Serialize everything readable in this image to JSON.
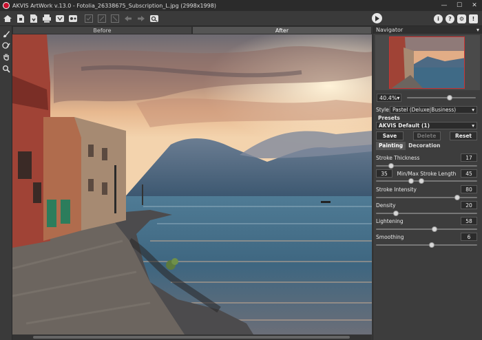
{
  "window": {
    "title": "AKVIS ArtWork v.13.0 - Fotolia_26338675_Subscription_L.jpg (2998x1998)",
    "min_symbol": "—",
    "max_symbol": "☐",
    "close_symbol": "✕"
  },
  "toolbar": {
    "icons": [
      "home-icon",
      "open-icon",
      "save-icon",
      "print-icon",
      "batch-icon",
      "plugins-icon",
      "apply-icon",
      "undo-disabled-icon",
      "redo-disabled-icon",
      "back-icon",
      "forward-icon",
      "compare-icon"
    ],
    "run_icon": "play-icon",
    "right_icons": [
      "about-icon",
      "help-icon",
      "settings-icon",
      "news-icon"
    ],
    "about_glyph": "i",
    "help_glyph": "?",
    "settings_glyph": "⚙",
    "news_glyph": "!"
  },
  "tools": [
    "brush-icon",
    "history-brush-icon",
    "hand-icon",
    "zoom-icon"
  ],
  "view_tabs": {
    "before": "Before",
    "after": "After"
  },
  "navigator": {
    "title": "Navigator",
    "zoom": "40.4%",
    "zoom_level_fraction": 0.62
  },
  "settings": {
    "style_label": "Style:",
    "style_value": "Pastel (Deluxe|Business)",
    "presets_label": "Presets",
    "preset_value": "AKVIS Default (1)",
    "save_label": "Save",
    "delete_label": "Delete",
    "reset_label": "Reset",
    "tab_painting": "Painting",
    "tab_decoration": "Decoration",
    "params": {
      "stroke_thickness": {
        "label": "Stroke Thickness",
        "value": "17",
        "level": 0.15
      },
      "stroke_length": {
        "label": "Min/Max Stroke Length",
        "min": "35",
        "max": "45",
        "min_level": 0.35,
        "max_level": 0.45
      },
      "stroke_intensity": {
        "label": "Stroke Intensity",
        "value": "80",
        "level": 0.8
      },
      "density": {
        "label": "Density",
        "value": "20",
        "level": 0.2
      },
      "lightening": {
        "label": "Lightening",
        "value": "58",
        "level": 0.58
      },
      "smoothing": {
        "label": "Smoothing",
        "value": "6",
        "level": 0.55
      }
    }
  },
  "colors": {
    "accent_red": "#c8102e",
    "panel_bg": "#3d3d3d"
  }
}
